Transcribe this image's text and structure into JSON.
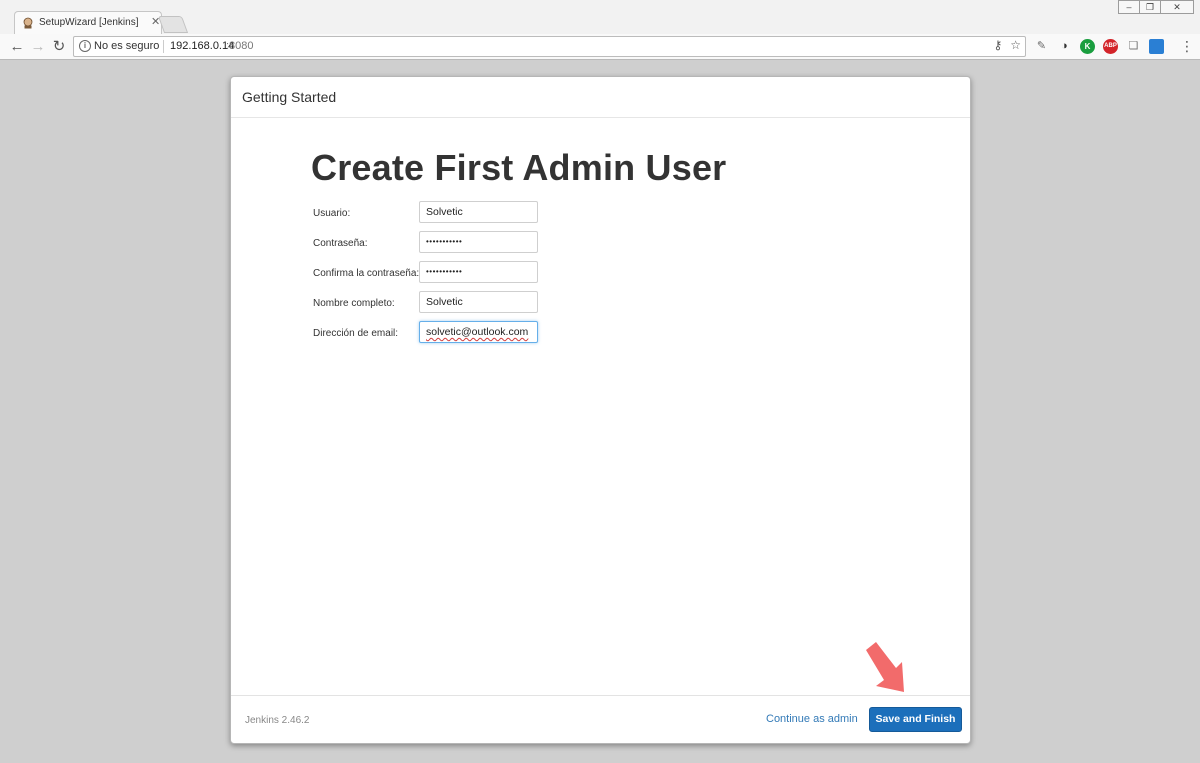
{
  "browser": {
    "tab_title": "SetupWizard [Jenkins]",
    "security_text": "No es seguro",
    "url_host": "192.168.0.14",
    "url_port": ":8080",
    "extensions": [
      {
        "icon": "pen-icon",
        "label": ""
      },
      {
        "icon": "eye-icon",
        "label": ""
      },
      {
        "icon": "k-icon",
        "label": "K",
        "color": "#1a9e3f"
      },
      {
        "icon": "adblock-icon",
        "label": "ABP",
        "color": "#d3242a"
      },
      {
        "icon": "stack-icon",
        "label": ""
      },
      {
        "icon": "square-icon",
        "label": ""
      }
    ]
  },
  "dialog": {
    "title": "Getting Started",
    "heading": "Create First Admin User",
    "fields": [
      {
        "label": "Usuario:",
        "value": "Solvetic",
        "type": "text"
      },
      {
        "label": "Contraseña:",
        "value": "•••••••••••",
        "type": "password"
      },
      {
        "label": "Confirma la contraseña:",
        "value": "•••••••••••",
        "type": "password"
      },
      {
        "label": "Nombre completo:",
        "value": "Solvetic",
        "type": "text"
      },
      {
        "label": "Dirección de email:",
        "value": "solvetic@outlook.com",
        "type": "email"
      }
    ],
    "footer": {
      "version": "Jenkins 2.46.2",
      "continue_label": "Continue as admin",
      "save_label": "Save and Finish"
    }
  },
  "colors": {
    "primary_button": "#1c6fbb",
    "link": "#337ab7",
    "annotation_arrow": "#f26b6b"
  }
}
